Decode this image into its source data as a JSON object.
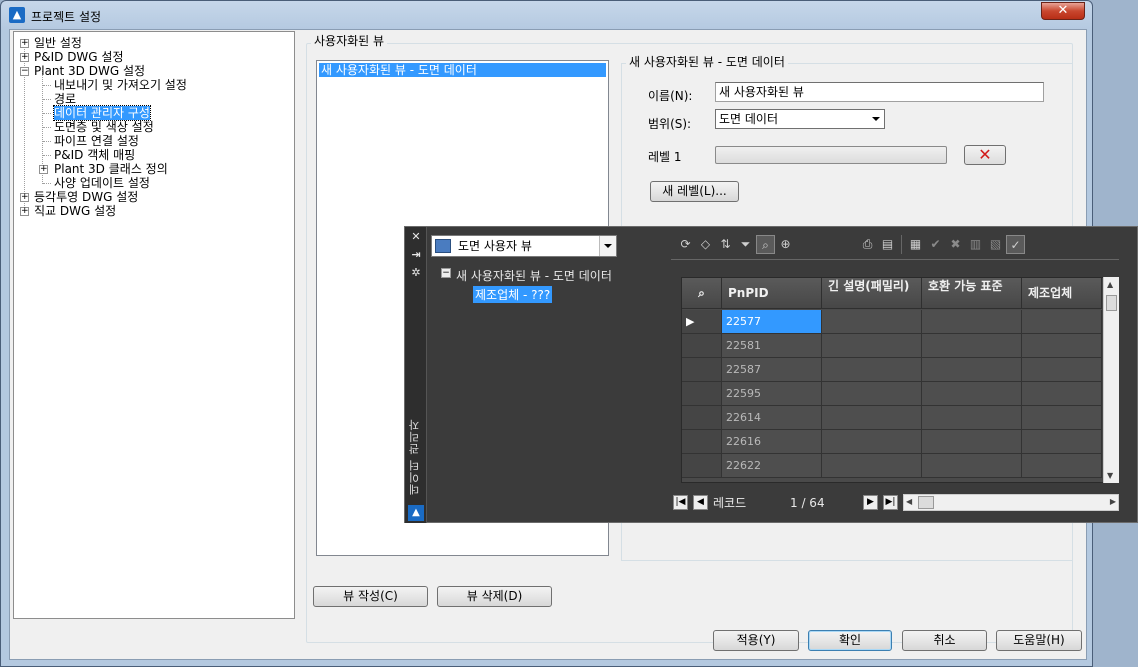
{
  "window": {
    "title": "프로젝트 설정",
    "close": "✕"
  },
  "tree": {
    "items": [
      {
        "label": "일반 설정",
        "expander": "+"
      },
      {
        "label": "P&ID DWG 설정",
        "expander": "+"
      },
      {
        "label": "Plant 3D DWG 설정",
        "expander": "−"
      },
      {
        "label": "내보내기 및 가져오기 설정"
      },
      {
        "label": "경로"
      },
      {
        "label": "데이터 관리자 구성",
        "selected": true
      },
      {
        "label": "도면층 및 색상 설정"
      },
      {
        "label": "파이프 연결 설정"
      },
      {
        "label": "P&ID 객체 매핑"
      },
      {
        "label": "Plant 3D 클래스 정의",
        "expander": "+"
      },
      {
        "label": "사양 업데이트 설정"
      },
      {
        "label": "등각투영 DWG 설정",
        "expander": "+"
      },
      {
        "label": "직교 DWG 설정",
        "expander": "+"
      }
    ]
  },
  "custom_views": {
    "group_label": "사용자화된 뷰",
    "list": [
      "새 사용자화된 뷰 - 도면 데이터"
    ],
    "create_button": "뷰 작성(C)",
    "delete_button": "뷰 삭제(D)"
  },
  "detail": {
    "group_label": "새 사용자화된 뷰 - 도면 데이터",
    "name_label": "이름(N):",
    "name_value": "새 사용자화된 뷰",
    "scope_label": "범위(S):",
    "scope_value": "도면 데이터",
    "level_label": "레벨 1",
    "remove_level": "✕",
    "new_level_button": "새 레벨(L)..."
  },
  "palette": {
    "side_title": "데이터 관리자",
    "view_combo": "도면 사용자 뷰",
    "tree_root": "새 사용자화된 뷰 - 도면 데이터",
    "tree_child": "제조업체 - ???",
    "columns": [
      "PnPID",
      "긴 설명(패밀리)",
      "호환 가능 표준",
      "제조업체"
    ],
    "rows": [
      "22577",
      "22581",
      "22587",
      "22595",
      "22614",
      "22616",
      "22622"
    ],
    "record_label": "레코드",
    "record_position": "1 / 64",
    "current_row_marker": "▶"
  },
  "footer": {
    "apply": "적용(Y)",
    "ok": "확인",
    "cancel": "취소",
    "help": "도움말(H)"
  }
}
